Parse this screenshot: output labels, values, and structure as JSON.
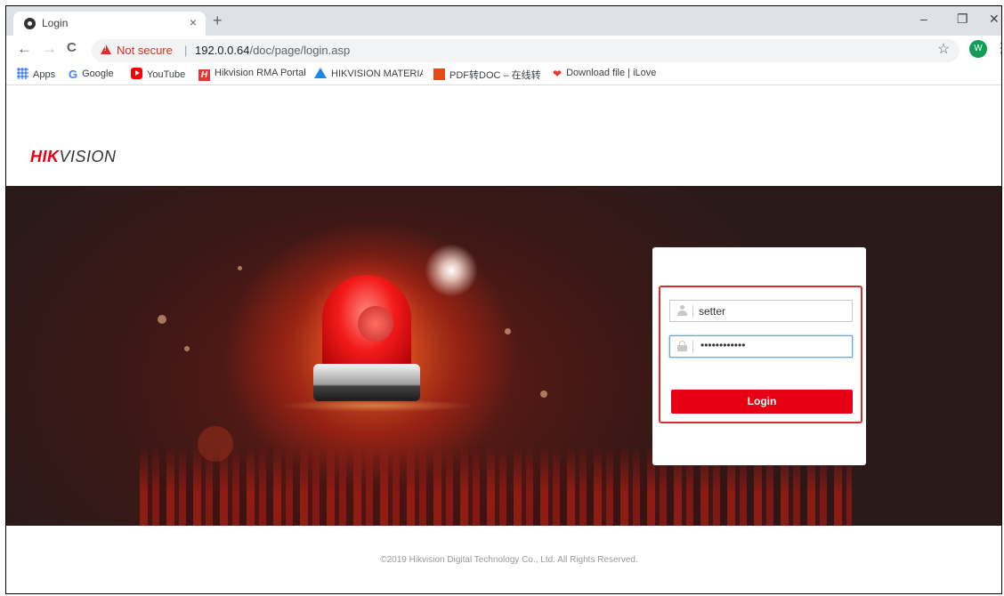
{
  "browser": {
    "tab_title": "Login",
    "tab_close": "×",
    "new_tab": "+",
    "window_controls": {
      "minimize": "–",
      "restore": "❐",
      "close": "✕"
    },
    "nav": {
      "back": "←",
      "forward": "→",
      "reload": "C"
    },
    "security_label": "Not secure",
    "separator": "|",
    "url_host": "192.0.0.64",
    "url_path": "/doc/page/login.asp",
    "bookmark_star": "☆",
    "profile_initial": "W",
    "menu": "⋮"
  },
  "bookmarks": [
    {
      "label": "Apps",
      "icon": "apps-icon"
    },
    {
      "label": "Google",
      "icon": "google-icon"
    },
    {
      "label": "YouTube",
      "icon": "youtube-icon"
    },
    {
      "label": "Hikvision RMA Portal",
      "icon": "hikvision-icon"
    },
    {
      "label": "HIKVISION MATERIAL",
      "icon": "drive-icon"
    },
    {
      "label": "PDF转DOC – 在线转",
      "icon": "pdf-icon"
    },
    {
      "label": "Download file | iLove",
      "icon": "heart-icon"
    }
  ],
  "page": {
    "logo_hik": "HIK",
    "logo_vision": "VISION",
    "login": {
      "username_value": "setter",
      "password_mask": "••••••••••••",
      "button_label": "Login"
    },
    "copyright": "©2019 Hikvision Digital Technology Co., Ltd. All Rights Reserved."
  },
  "colors": {
    "brand_red": "#e60012",
    "highlight_border": "#d32f2f",
    "security_warning": "#d93025"
  }
}
